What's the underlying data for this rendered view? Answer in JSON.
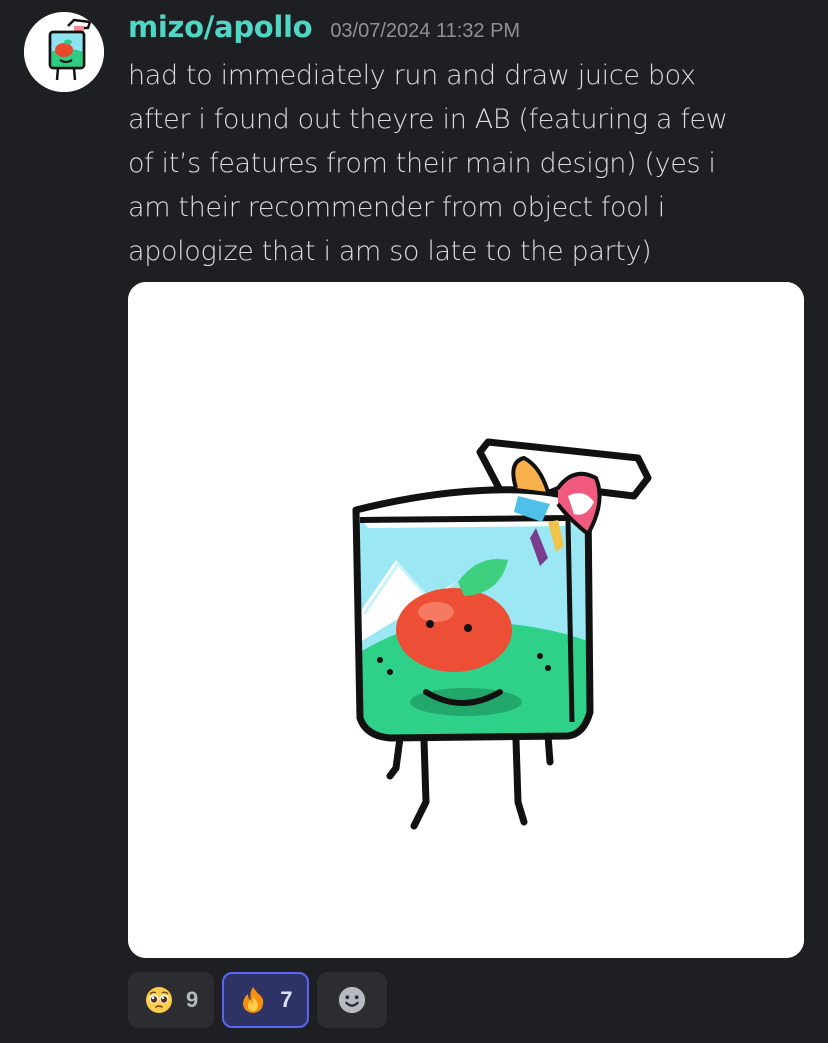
{
  "author": {
    "username": "mizo/apollo",
    "timestamp": "03/07/2024 11:32 PM",
    "name_color": "#4fd6c5"
  },
  "message": {
    "lines": [
      "had to immediately run and draw juice box",
      "after i found out theyre in AB (featuring a few",
      "of it’s features from their main design) (yes i",
      "am their recommender from object fool i",
      "apologize that i am so late to the party)"
    ]
  },
  "attachment": {
    "type": "image",
    "subject": "juice-box-character-drawing"
  },
  "reactions": [
    {
      "icon": "pleading-face-emoji",
      "count": "9",
      "active": false
    },
    {
      "icon": "fire-emoji",
      "count": "7",
      "active": true
    }
  ],
  "add_reaction": {
    "icon": "add-reaction-smiley-icon"
  },
  "colors": {
    "background": "#1e1f22",
    "text": "#dbdee1",
    "timestamp": "#8e9297",
    "reaction_bg": "#2b2d31",
    "reaction_active_bg": "#2e3366",
    "reaction_active_border": "#5865f2"
  }
}
